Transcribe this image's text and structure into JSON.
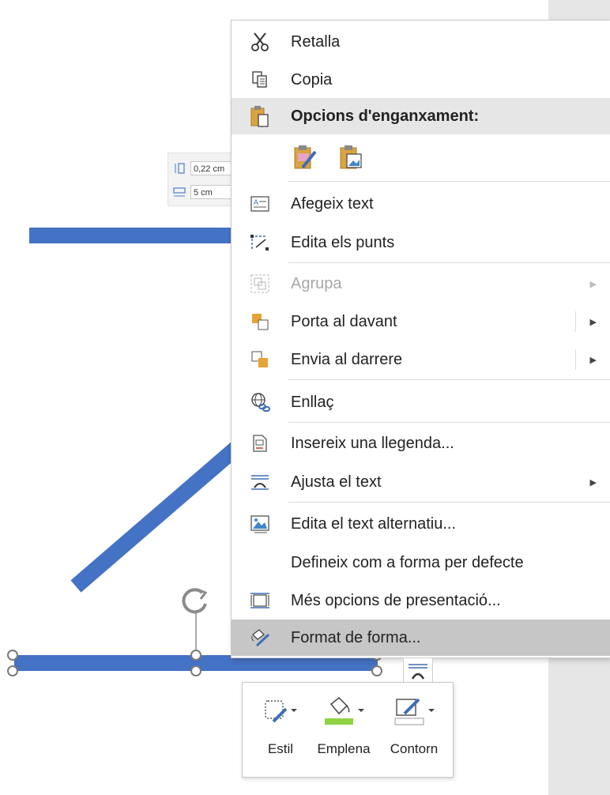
{
  "colors": {
    "shape_blue": "#4472c4",
    "menu_highlight": "#c6c6c6",
    "header_bg": "#e6e6e6",
    "fill_green": "#8ed243"
  },
  "size_panel": {
    "height": "0,22 cm",
    "width": "5 cm"
  },
  "context_menu": {
    "items": [
      {
        "label": "Retalla",
        "icon": "scissors-icon"
      },
      {
        "label": "Copia",
        "icon": "copy-icon"
      },
      {
        "label": "Opcions d'enganxament:",
        "icon": "paste-icon"
      },
      {
        "label": "Afegeix text",
        "icon": "add-text-icon"
      },
      {
        "label": "Edita els punts",
        "icon": "edit-points-icon"
      },
      {
        "label": "Agrupa",
        "icon": "group-icon",
        "disabled": true
      },
      {
        "label": "Porta al davant",
        "icon": "bring-forward-icon"
      },
      {
        "label": "Envia al darrere",
        "icon": "send-backward-icon"
      },
      {
        "label": "Enllaç",
        "icon": "link-icon"
      },
      {
        "label": "Insereix una llegenda...",
        "icon": "insert-caption-icon"
      },
      {
        "label": "Ajusta el text",
        "icon": "wrap-text-icon"
      },
      {
        "label": "Edita el text alternatiu...",
        "icon": "alt-text-icon"
      },
      {
        "label": "Defineix com a forma per defecte",
        "icon": ""
      },
      {
        "label": "Més opcions de presentació...",
        "icon": "layout-options-icon"
      },
      {
        "label": "Format de forma...",
        "icon": "format-shape-icon",
        "highlighted": true
      }
    ],
    "paste_options": [
      "paste-keep-formatting-icon",
      "paste-picture-icon"
    ]
  },
  "mini_toolbar": {
    "style_label": "Estil",
    "fill_label": "Emplena",
    "outline_label": "Contorn"
  }
}
